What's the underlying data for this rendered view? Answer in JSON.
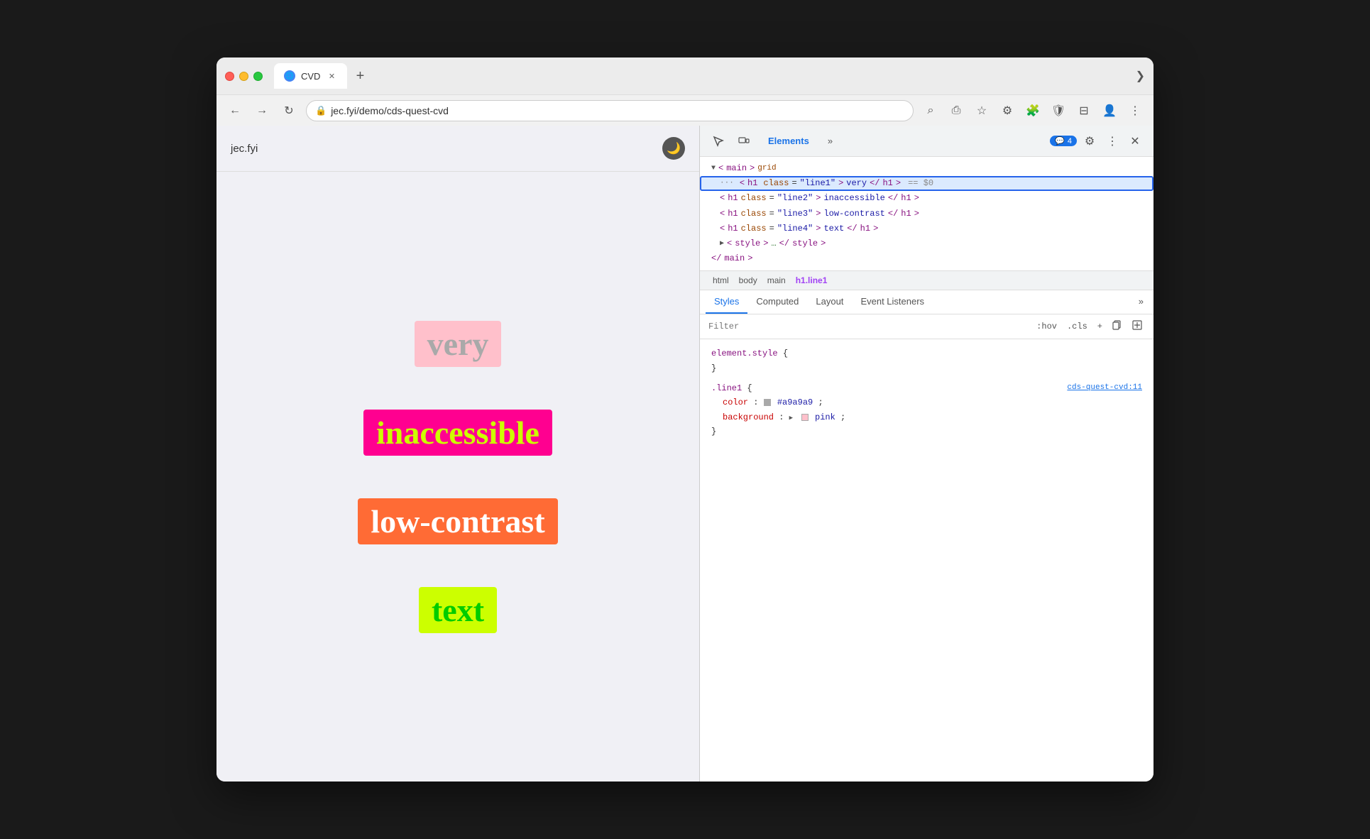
{
  "browser": {
    "tab_title": "CVD",
    "tab_favicon": "🌐",
    "url": "jec.fyi/demo/cds-quest-cvd",
    "new_tab_label": "+",
    "tab_more_label": "❯"
  },
  "nav": {
    "back_icon": "←",
    "forward_icon": "→",
    "refresh_icon": "↻",
    "lock_icon": "🔒",
    "search_icon": "⌕",
    "share_icon": "⎙",
    "star_icon": "☆",
    "extensions_icon": "⚙",
    "puzzle_icon": "🧩",
    "shield_icon": "🛡",
    "sidebar_icon": "⊟",
    "account_icon": "👤",
    "menu_icon": "⋮"
  },
  "page": {
    "logo": "jec.fyi",
    "dark_mode_icon": "🌙",
    "texts": [
      {
        "content": "very",
        "class": "text-very"
      },
      {
        "content": "inaccessible",
        "class": "text-inaccessible"
      },
      {
        "content": "low-contrast",
        "class": "text-low-contrast"
      },
      {
        "content": "text",
        "class": "text-text"
      }
    ]
  },
  "devtools": {
    "toolbar": {
      "inspect_icon": "↖",
      "device_icon": "⊡",
      "elements_tab": "Elements",
      "more_tabs_icon": "»",
      "badge_icon": "💬",
      "badge_count": "4",
      "settings_icon": "⚙",
      "menu_icon": "⋮",
      "close_icon": "✕"
    },
    "dom_tree": {
      "rows": [
        {
          "indent": 0,
          "content": "<main> grid",
          "type": "tag",
          "has_triangle": true,
          "selected": false
        },
        {
          "indent": 1,
          "content": "<h1 class=\"line1\">very</h1>",
          "type": "selected",
          "selected": true,
          "suffix": "== $0"
        },
        {
          "indent": 1,
          "content": "<h1 class=\"line2\">inaccessible</h1>",
          "type": "tag",
          "selected": false
        },
        {
          "indent": 1,
          "content": "<h1 class=\"line3\">low-contrast</h1>",
          "type": "tag",
          "selected": false
        },
        {
          "indent": 1,
          "content": "<h1 class=\"line4\">text</h1>",
          "type": "tag",
          "selected": false
        },
        {
          "indent": 1,
          "content": "<style>…</style>",
          "type": "tag",
          "has_triangle": true,
          "selected": false
        },
        {
          "indent": 0,
          "content": "</main>",
          "type": "tag",
          "selected": false
        }
      ]
    },
    "breadcrumb": {
      "items": [
        {
          "label": "html",
          "active": false
        },
        {
          "label": "body",
          "active": false
        },
        {
          "label": "main",
          "active": false
        },
        {
          "label": "h1.line1",
          "active": true
        }
      ]
    },
    "styles": {
      "tabs": [
        {
          "label": "Styles",
          "active": true
        },
        {
          "label": "Computed",
          "active": false
        },
        {
          "label": "Layout",
          "active": false
        },
        {
          "label": "Event Listeners",
          "active": false
        }
      ],
      "filter_placeholder": "Filter",
      "filter_actions": [
        ":hov",
        ".cls",
        "+"
      ],
      "rules": [
        {
          "selector": "element.style {",
          "source": "",
          "properties": []
        },
        {
          "selector": ".line1 {",
          "source": "cds-quest-cvd:11",
          "properties": [
            {
              "name": "color",
              "value": "#a9a9a9",
              "has_swatch": true,
              "swatch_color": "#a9a9a9"
            },
            {
              "name": "background",
              "value": "pink",
              "has_swatch": true,
              "swatch_color": "pink"
            }
          ]
        }
      ]
    }
  }
}
